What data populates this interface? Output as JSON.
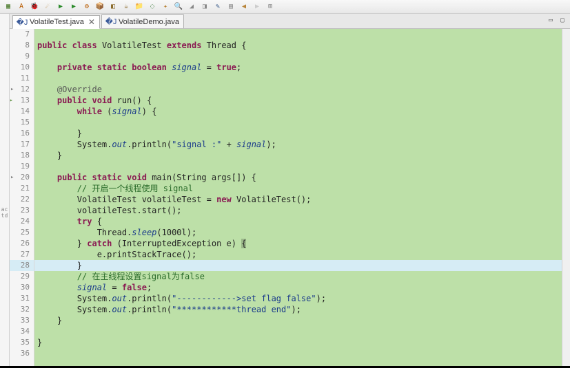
{
  "toolbar": {
    "icons": [
      "db-icon",
      "a-icon",
      "bug-icon",
      "torch-icon",
      "run-icon",
      "run-ext-icon",
      "gear-icon",
      "package-icon",
      "build-icon",
      "cup-icon",
      "proj-icon",
      "class-icon",
      "sparkle-icon",
      "search-icon",
      "tag-icon",
      "nav-icon",
      "brush-icon",
      "filter-icon",
      "back-icon",
      "fwd-icon",
      "type-icon"
    ]
  },
  "tabs": [
    {
      "label": "VolatileTest.java",
      "active": true
    },
    {
      "label": "VolatileDemo.java",
      "active": false
    }
  ],
  "left_strip": {
    "l1": "ac",
    "l2": "td"
  },
  "code": {
    "lines": [
      {
        "n": 7,
        "segs": [
          {
            "t": "",
            "c": ""
          }
        ]
      },
      {
        "n": 8,
        "segs": [
          {
            "t": "public ",
            "c": "kw"
          },
          {
            "t": "class ",
            "c": "kw"
          },
          {
            "t": "VolatileTest ",
            "c": "classname"
          },
          {
            "t": "extends ",
            "c": "kw"
          },
          {
            "t": "Thread {",
            "c": ""
          }
        ]
      },
      {
        "n": 9,
        "segs": [
          {
            "t": "",
            "c": ""
          }
        ]
      },
      {
        "n": 10,
        "segs": [
          {
            "t": "    ",
            "c": ""
          },
          {
            "t": "private static boolean ",
            "c": "kw"
          },
          {
            "t": "signal",
            "c": "static-field"
          },
          {
            "t": " = ",
            "c": ""
          },
          {
            "t": "true",
            "c": "kw"
          },
          {
            "t": ";",
            "c": ""
          }
        ]
      },
      {
        "n": 11,
        "segs": [
          {
            "t": "",
            "c": ""
          }
        ]
      },
      {
        "n": 12,
        "folded": true,
        "segs": [
          {
            "t": "    ",
            "c": ""
          },
          {
            "t": "@Override",
            "c": "annot"
          }
        ]
      },
      {
        "n": 13,
        "marker": true,
        "segs": [
          {
            "t": "    ",
            "c": ""
          },
          {
            "t": "public void ",
            "c": "kw"
          },
          {
            "t": "run() {",
            "c": ""
          }
        ]
      },
      {
        "n": 14,
        "segs": [
          {
            "t": "        ",
            "c": ""
          },
          {
            "t": "while ",
            "c": "kw"
          },
          {
            "t": "(",
            "c": ""
          },
          {
            "t": "signal",
            "c": "static-field"
          },
          {
            "t": ") {",
            "c": ""
          }
        ]
      },
      {
        "n": 15,
        "segs": [
          {
            "t": "",
            "c": ""
          }
        ]
      },
      {
        "n": 16,
        "segs": [
          {
            "t": "        }",
            "c": ""
          }
        ]
      },
      {
        "n": 17,
        "segs": [
          {
            "t": "        System.",
            "c": ""
          },
          {
            "t": "out",
            "c": "static-field"
          },
          {
            "t": ".println(",
            "c": ""
          },
          {
            "t": "\"signal :\"",
            "c": "str"
          },
          {
            "t": " + ",
            "c": ""
          },
          {
            "t": "signal",
            "c": "static-field"
          },
          {
            "t": ");",
            "c": ""
          }
        ]
      },
      {
        "n": 18,
        "segs": [
          {
            "t": "    }",
            "c": ""
          }
        ]
      },
      {
        "n": 19,
        "segs": [
          {
            "t": "",
            "c": ""
          }
        ]
      },
      {
        "n": 20,
        "folded": true,
        "segs": [
          {
            "t": "    ",
            "c": ""
          },
          {
            "t": "public static void ",
            "c": "kw"
          },
          {
            "t": "main(String args[]) {",
            "c": ""
          }
        ]
      },
      {
        "n": 21,
        "segs": [
          {
            "t": "        ",
            "c": ""
          },
          {
            "t": "// 开启一个线程使用 signal",
            "c": "comment"
          }
        ]
      },
      {
        "n": 22,
        "segs": [
          {
            "t": "        VolatileTest volatileTest = ",
            "c": ""
          },
          {
            "t": "new ",
            "c": "kw"
          },
          {
            "t": "VolatileTest();",
            "c": ""
          }
        ]
      },
      {
        "n": 23,
        "segs": [
          {
            "t": "        volatileTest.start();",
            "c": ""
          }
        ]
      },
      {
        "n": 24,
        "segs": [
          {
            "t": "        ",
            "c": ""
          },
          {
            "t": "try ",
            "c": "kw"
          },
          {
            "t": "{",
            "c": ""
          }
        ]
      },
      {
        "n": 25,
        "segs": [
          {
            "t": "            Thread.",
            "c": ""
          },
          {
            "t": "sleep",
            "c": "field"
          },
          {
            "t": "(1000l);",
            "c": ""
          }
        ]
      },
      {
        "n": 26,
        "segs": [
          {
            "t": "        } ",
            "c": ""
          },
          {
            "t": "catch ",
            "c": "kw"
          },
          {
            "t": "(InterruptedException e) ",
            "c": ""
          },
          {
            "t": "{",
            "c": "sel-box"
          }
        ]
      },
      {
        "n": 27,
        "segs": [
          {
            "t": "            e.printStackTrace();",
            "c": ""
          }
        ]
      },
      {
        "n": 28,
        "current": true,
        "segs": [
          {
            "t": "        }",
            "c": ""
          }
        ]
      },
      {
        "n": 29,
        "segs": [
          {
            "t": "        ",
            "c": ""
          },
          {
            "t": "// 在主线程设置signal为false",
            "c": "comment"
          }
        ]
      },
      {
        "n": 30,
        "segs": [
          {
            "t": "        ",
            "c": ""
          },
          {
            "t": "signal",
            "c": "static-field"
          },
          {
            "t": " = ",
            "c": ""
          },
          {
            "t": "false",
            "c": "kw"
          },
          {
            "t": ";",
            "c": ""
          }
        ]
      },
      {
        "n": 31,
        "segs": [
          {
            "t": "        System.",
            "c": ""
          },
          {
            "t": "out",
            "c": "static-field"
          },
          {
            "t": ".println(",
            "c": ""
          },
          {
            "t": "\"------------>set flag false\"",
            "c": "str"
          },
          {
            "t": ");",
            "c": ""
          }
        ]
      },
      {
        "n": 32,
        "segs": [
          {
            "t": "        System.",
            "c": ""
          },
          {
            "t": "out",
            "c": "static-field"
          },
          {
            "t": ".println(",
            "c": ""
          },
          {
            "t": "\"************thread end\"",
            "c": "str"
          },
          {
            "t": ");",
            "c": ""
          }
        ]
      },
      {
        "n": 33,
        "segs": [
          {
            "t": "    }",
            "c": ""
          }
        ]
      },
      {
        "n": 34,
        "segs": [
          {
            "t": "",
            "c": ""
          }
        ]
      },
      {
        "n": 35,
        "segs": [
          {
            "t": "}",
            "c": ""
          }
        ]
      },
      {
        "n": 36,
        "segs": [
          {
            "t": "",
            "c": ""
          }
        ]
      }
    ]
  }
}
